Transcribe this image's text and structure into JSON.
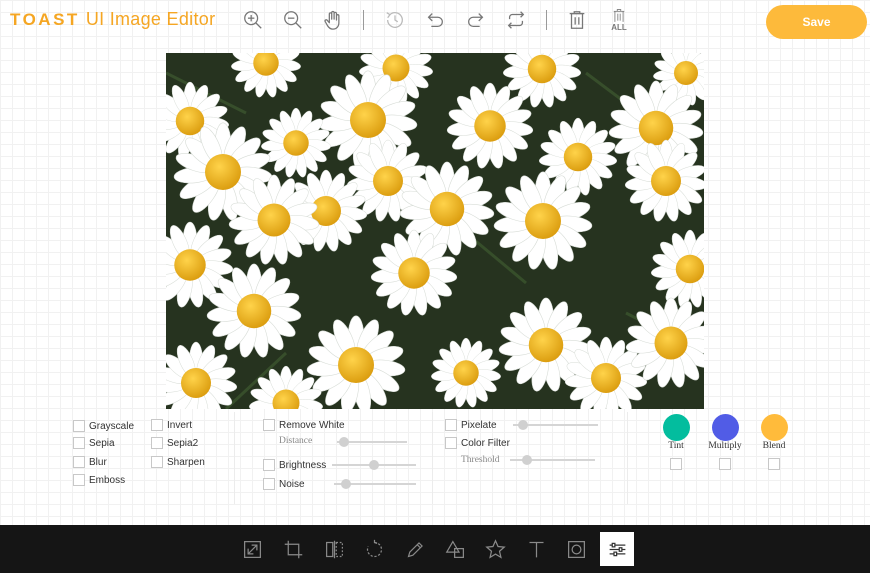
{
  "header": {
    "brand": "TOAST",
    "title": "UI Image Editor",
    "save_label": "Save",
    "tools": [
      "zoom-in",
      "zoom-out",
      "hand",
      "history",
      "undo",
      "redo",
      "reset",
      "delete",
      "delete-all"
    ],
    "delete_all_text": "ALL"
  },
  "canvas": {
    "image": "white daisy flowers photo"
  },
  "filters": {
    "column1": [
      "Grayscale",
      "Sepia",
      "Blur",
      "Emboss"
    ],
    "column2": [
      "Invert",
      "Sepia2",
      "Sharpen"
    ],
    "remove_white": {
      "label": "Remove White",
      "sub_label": "Distance",
      "value": 0.1
    },
    "brightness": {
      "label": "Brightness",
      "value": 0.5
    },
    "noise": {
      "label": "Noise",
      "value": 0.15
    },
    "pixelate": {
      "label": "Pixelate",
      "value": 0.12
    },
    "color_filter": {
      "label": "Color Filter",
      "sub_label": "Threshold",
      "value": 0.2
    },
    "blends": [
      {
        "label": "Tint",
        "color": "#03bd9e"
      },
      {
        "label": "Multiply",
        "color": "#515ce6"
      },
      {
        "label": "Blend",
        "color": "#ffbb3b"
      }
    ]
  },
  "toolbar": {
    "tools": [
      "resize",
      "crop",
      "flip",
      "rotate",
      "draw",
      "shape",
      "icon",
      "text",
      "mask",
      "filter"
    ],
    "active": "filter"
  }
}
